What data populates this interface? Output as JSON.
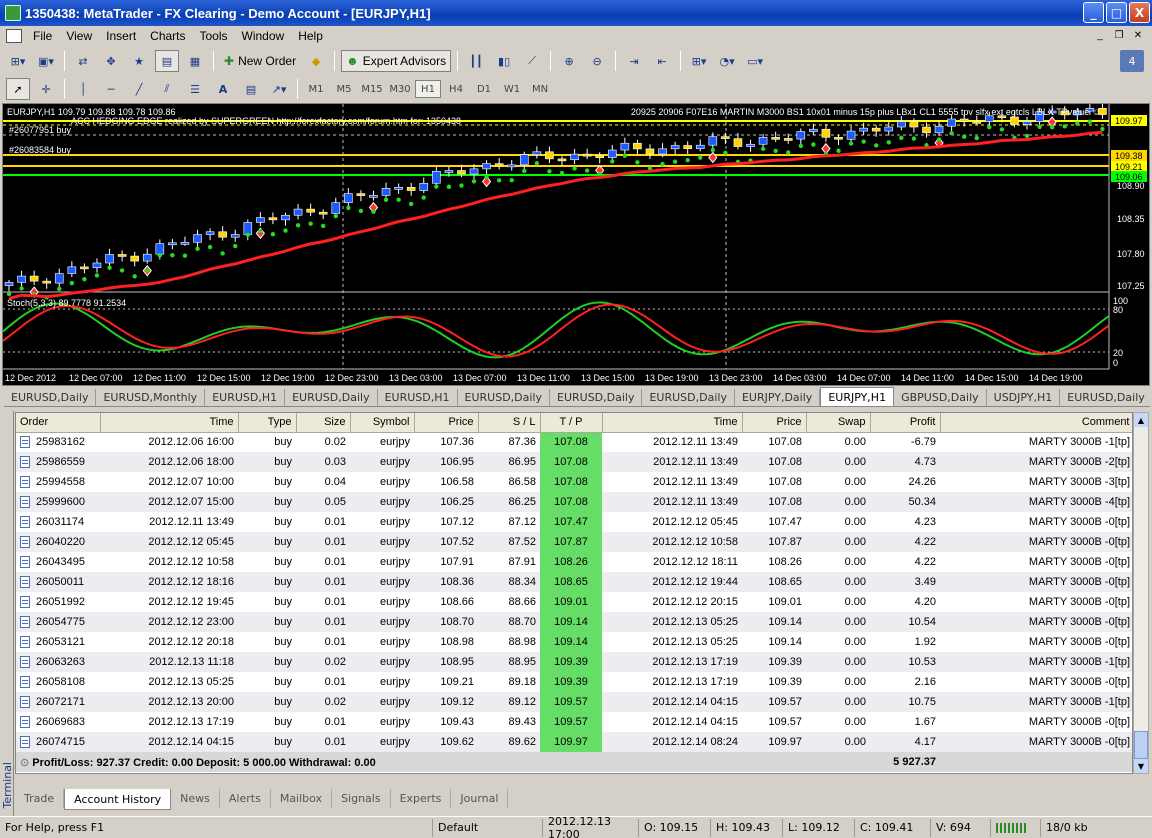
{
  "window": {
    "title": "1350438: MetaTrader - FX Clearing - Demo Account - [EURJPY,H1]",
    "buttons": [
      "_",
      "□",
      "X"
    ]
  },
  "menu": [
    "File",
    "View",
    "Insert",
    "Charts",
    "Tools",
    "Window",
    "Help"
  ],
  "toolbar": {
    "new_order": "New Order",
    "expert_advisors": "Expert Advisors",
    "timeframes": [
      "M1",
      "M5",
      "M15",
      "M30",
      "H1",
      "H4",
      "D1",
      "W1",
      "MN"
    ],
    "active_timeframe": "H1",
    "counter": "4"
  },
  "chart": {
    "symbol_line": "EURJPY,H1  109.79 109.88 109.78 109.86",
    "ea_line": "ACC HEDGING EDGE realized by SUPERGREEN http://forexfactory.com/forum.htm for: 1350438",
    "info_line": "20925 20906 F07E16 MARTIN M3000 BS1 10x01 minus 15p plus LBx1 CL1 5555 tpv slfx ext egtcls LBLX TPvalue ☺",
    "order_labels": [
      "#26077951 buy",
      "#26083584 buy"
    ],
    "price_ticks": [
      "108.90",
      "108.35",
      "107.80",
      "107.25"
    ],
    "price_tags": [
      {
        "label": "109.97",
        "color": "#ffff00"
      },
      {
        "label": "109.38",
        "color": "#ffd700"
      },
      {
        "label": "109.21",
        "color": "#ffff00"
      },
      {
        "label": "109.06",
        "color": "#00ff00"
      }
    ],
    "stoch_label": "Stoch(5,3,3) 89.7778 91.2534",
    "stoch_ticks": [
      "100",
      "80",
      "20",
      "0"
    ],
    "time_labels": [
      "12 Dec 2012",
      "12 Dec 07:00",
      "12 Dec 11:00",
      "12 Dec 15:00",
      "12 Dec 19:00",
      "12 Dec 23:00",
      "13 Dec 03:00",
      "13 Dec 07:00",
      "13 Dec 11:00",
      "13 Dec 15:00",
      "13 Dec 19:00",
      "13 Dec 23:00",
      "14 Dec 03:00",
      "14 Dec 07:00",
      "14 Dec 11:00",
      "14 Dec 15:00",
      "14 Dec 19:00"
    ]
  },
  "chart_tabs": [
    "EURUSD,Daily",
    "EURUSD,Monthly",
    "EURUSD,H1",
    "EURUSD,Daily",
    "EURUSD,H1",
    "EURUSD,Daily",
    "EURUSD,Daily",
    "EURUSD,Daily",
    "EURJPY,Daily",
    "EURJPY,H1",
    "GBPUSD,Daily",
    "USDJPY,H1",
    "EURUSD,Daily"
  ],
  "active_chart_tab": "EURJPY,H1",
  "terminal": {
    "side_label": "Terminal",
    "columns": [
      "Order",
      "Time",
      "Type",
      "Size",
      "Symbol",
      "Price",
      "S / L",
      "T / P",
      "Time",
      "Price",
      "Swap",
      "Profit",
      "Comment"
    ],
    "rows": [
      [
        "25983162",
        "2012.12.06 16:00",
        "buy",
        "0.02",
        "eurjpy",
        "107.36",
        "87.36",
        "107.08",
        "2012.12.11 13:49",
        "107.08",
        "0.00",
        "-6.79",
        "MARTY 3000B -1[tp]"
      ],
      [
        "25986559",
        "2012.12.06 18:00",
        "buy",
        "0.03",
        "eurjpy",
        "106.95",
        "86.95",
        "107.08",
        "2012.12.11 13:49",
        "107.08",
        "0.00",
        "4.73",
        "MARTY 3000B -2[tp]"
      ],
      [
        "25994558",
        "2012.12.07 10:00",
        "buy",
        "0.04",
        "eurjpy",
        "106.58",
        "86.58",
        "107.08",
        "2012.12.11 13:49",
        "107.08",
        "0.00",
        "24.26",
        "MARTY 3000B -3[tp]"
      ],
      [
        "25999600",
        "2012.12.07 15:00",
        "buy",
        "0.05",
        "eurjpy",
        "106.25",
        "86.25",
        "107.08",
        "2012.12.11 13:49",
        "107.08",
        "0.00",
        "50.34",
        "MARTY 3000B -4[tp]"
      ],
      [
        "26031174",
        "2012.12.11 13:49",
        "buy",
        "0.01",
        "eurjpy",
        "107.12",
        "87.12",
        "107.47",
        "2012.12.12 05:45",
        "107.47",
        "0.00",
        "4.23",
        "MARTY 3000B -0[tp]"
      ],
      [
        "26040220",
        "2012.12.12 05:45",
        "buy",
        "0.01",
        "eurjpy",
        "107.52",
        "87.52",
        "107.87",
        "2012.12.12 10:58",
        "107.87",
        "0.00",
        "4.22",
        "MARTY 3000B -0[tp]"
      ],
      [
        "26043495",
        "2012.12.12 10:58",
        "buy",
        "0.01",
        "eurjpy",
        "107.91",
        "87.91",
        "108.26",
        "2012.12.12 18:11",
        "108.26",
        "0.00",
        "4.22",
        "MARTY 3000B -0[tp]"
      ],
      [
        "26050011",
        "2012.12.12 18:16",
        "buy",
        "0.01",
        "eurjpy",
        "108.36",
        "88.34",
        "108.65",
        "2012.12.12 19:44",
        "108.65",
        "0.00",
        "3.49",
        "MARTY 3000B -0[tp]"
      ],
      [
        "26051992",
        "2012.12.12 19:45",
        "buy",
        "0.01",
        "eurjpy",
        "108.66",
        "88.66",
        "109.01",
        "2012.12.12 20:15",
        "109.01",
        "0.00",
        "4.20",
        "MARTY 3000B -0[tp]"
      ],
      [
        "26054775",
        "2012.12.12 23:00",
        "buy",
        "0.01",
        "eurjpy",
        "108.70",
        "88.70",
        "109.14",
        "2012.12.13 05:25",
        "109.14",
        "0.00",
        "10.54",
        "MARTY 3000B -0[tp]"
      ],
      [
        "26053121",
        "2012.12.12 20:18",
        "buy",
        "0.01",
        "eurjpy",
        "108.98",
        "88.98",
        "109.14",
        "2012.12.13 05:25",
        "109.14",
        "0.00",
        "1.92",
        "MARTY 3000B -0[tp]"
      ],
      [
        "26063263",
        "2012.12.13 11:18",
        "buy",
        "0.02",
        "eurjpy",
        "108.95",
        "88.95",
        "109.39",
        "2012.12.13 17:19",
        "109.39",
        "0.00",
        "10.53",
        "MARTY 3000B -1[tp]"
      ],
      [
        "26058108",
        "2012.12.13 05:25",
        "buy",
        "0.01",
        "eurjpy",
        "109.21",
        "89.18",
        "109.39",
        "2012.12.13 17:19",
        "109.39",
        "0.00",
        "2.16",
        "MARTY 3000B -0[tp]"
      ],
      [
        "26072171",
        "2012.12.13 20:00",
        "buy",
        "0.02",
        "eurjpy",
        "109.12",
        "89.12",
        "109.57",
        "2012.12.14 04:15",
        "109.57",
        "0.00",
        "10.75",
        "MARTY 3000B -1[tp]"
      ],
      [
        "26069683",
        "2012.12.13 17:19",
        "buy",
        "0.01",
        "eurjpy",
        "109.43",
        "89.43",
        "109.57",
        "2012.12.14 04:15",
        "109.57",
        "0.00",
        "1.67",
        "MARTY 3000B -0[tp]"
      ],
      [
        "26074715",
        "2012.12.14 04:15",
        "buy",
        "0.01",
        "eurjpy",
        "109.62",
        "89.62",
        "109.97",
        "2012.12.14 08:24",
        "109.97",
        "0.00",
        "4.17",
        "MARTY 3000B -0[tp]"
      ]
    ],
    "summary": {
      "text": "Profit/Loss: 927.37  Credit: 0.00  Deposit: 5 000.00  Withdrawal: 0.00",
      "total": "5 927.37"
    },
    "tabs": [
      "Trade",
      "Account History",
      "News",
      "Alerts",
      "Mailbox",
      "Signals",
      "Experts",
      "Journal"
    ],
    "active_tab": "Account History"
  },
  "status": {
    "help": "For Help, press F1",
    "profile": "Default",
    "datetime": "2012.12.13 17:00",
    "open": "O: 109.15",
    "high": "H: 109.43",
    "low": "L: 109.12",
    "close": "C: 109.41",
    "volume": "V: 694",
    "traffic": "18/0 kb"
  }
}
